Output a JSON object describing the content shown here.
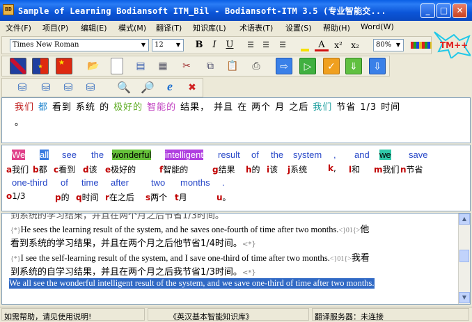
{
  "window": {
    "title": "Sample of Learning Bodiansoft ITM_Bil - Bodiansoft-ITM 3.5 (专业智能交...",
    "app_icon_text": "BD",
    "buttons": {
      "minimize": "_",
      "maximize": "□",
      "close": "✕"
    }
  },
  "menu": {
    "items": [
      "文件(F)",
      "项目(P)",
      "编辑(E)",
      "模式(M)",
      "翻译(T)",
      "知识库(L)",
      "术语表(T)",
      "设置(S)",
      "帮助(H)",
      "Word(W)"
    ]
  },
  "format_toolbar": {
    "font_name": "Times New Roman",
    "font_size": "12",
    "bold": "B",
    "italic": "I",
    "underline": "U",
    "superscript": "x²",
    "subscript": "x₂",
    "zoom": "80%"
  },
  "tm_badge": "TM++",
  "source_pane": {
    "words": [
      {
        "text": "我们",
        "color": "#C02020"
      },
      {
        "text": "都",
        "color": "#2A8AD0"
      },
      {
        "text": "看到",
        "color": "#000000"
      },
      {
        "text": "系统",
        "color": "#000000"
      },
      {
        "text": "的",
        "color": "#000000"
      },
      {
        "text": "极好的",
        "color": "#5AAA1E"
      },
      {
        "text": "智能的",
        "color": "#C040C0"
      },
      {
        "text": "结果，",
        "color": "#000000"
      },
      {
        "text": "并且",
        "color": "#000000"
      },
      {
        "text": "在",
        "color": "#000000"
      },
      {
        "text": "两个",
        "color": "#000000"
      },
      {
        "text": "月",
        "color": "#000000"
      },
      {
        "text": "之后",
        "color": "#000000"
      },
      {
        "text": "我们",
        "color": "#20A0A0"
      },
      {
        "text": "节省",
        "color": "#000000"
      },
      {
        "text": "1/3",
        "color": "#000000"
      },
      {
        "text": "时间",
        "color": "#000000"
      }
    ],
    "end_mark": "。"
  },
  "alignment_pane": {
    "english_row1": [
      {
        "text": "We",
        "bg": "#E0408A"
      },
      {
        "text": "all",
        "bg": "#3A7CE0"
      },
      {
        "text": "see",
        "bg": ""
      },
      {
        "text": "the",
        "bg": ""
      },
      {
        "text": "wonderful",
        "bg": "#66C23A"
      },
      {
        "text": "intelligent",
        "bg": "#B040E0"
      },
      {
        "text": "result",
        "bg": ""
      },
      {
        "text": "of",
        "bg": ""
      },
      {
        "text": "the",
        "bg": ""
      },
      {
        "text": "system",
        "bg": ""
      },
      {
        "text": ",",
        "bg": ""
      },
      {
        "text": "and",
        "bg": ""
      },
      {
        "text": "we",
        "bg": "#30C8A8"
      },
      {
        "text": "save",
        "bg": ""
      }
    ],
    "chinese_row1": [
      {
        "tag": "a",
        "text": "我们"
      },
      {
        "tag": "b",
        "text": "都"
      },
      {
        "tag": "c",
        "text": "看到"
      },
      {
        "tag": "d",
        "text": "该"
      },
      {
        "tag": "e",
        "text": "极好的"
      },
      {
        "tag": "f",
        "text": "智能的"
      },
      {
        "tag": "g",
        "text": "结果"
      },
      {
        "tag": "h",
        "text": "的"
      },
      {
        "tag": "i",
        "text": "该"
      },
      {
        "tag": "j",
        "text": "系统"
      },
      {
        "tag": "k",
        "text": ","
      },
      {
        "tag": "l",
        "text": "和"
      },
      {
        "tag": "m",
        "text": "我们"
      },
      {
        "tag": "n",
        "text": "节省"
      }
    ],
    "english_row2": [
      "one-third",
      "of",
      "time",
      "after",
      "two",
      "months",
      "."
    ],
    "chinese_row2": [
      {
        "tag": "o",
        "text": "1/3"
      },
      {
        "tag": "p",
        "text": "的"
      },
      {
        "tag": "q",
        "text": "时间"
      },
      {
        "tag": "r",
        "text": "在之后"
      },
      {
        "tag": "s",
        "text": "两个"
      },
      {
        "tag": "t",
        "text": "月"
      },
      {
        "tag": "u",
        "text": "。"
      }
    ]
  },
  "memory_pane": {
    "partial_line": "到系统的学习结果，并且在两个月之后节省1/3时间。",
    "entries": [
      {
        "open_tag": "{*}",
        "english": "He sees the learning result of the system, and he saves one-fourth of time after two months.",
        "mid_tag": "<}01{>",
        "chinese_start": "他"
      },
      {
        "chinese_rest": "看到系统的学习结果，并且在两个月之后他节省1/4时间。",
        "close_tag": "<*}"
      },
      {
        "open_tag": "{*}",
        "english": "I see the self-learning result of the system, and I save one-third of time after two months.",
        "mid_tag": "<}01{>",
        "chinese_start": "我看"
      },
      {
        "chinese_rest": "到系统的自学习结果，并且在两个月之后我节省1/3时间。",
        "close_tag": "<*}"
      }
    ],
    "selected_line": "We all see the wonderful intelligent result of the system, and we save one-third of time after two months."
  },
  "status_bar": {
    "help": "如需帮助，请见使用说明!",
    "kb": "《英汉基本智能知识库》",
    "server": "翻译服务器：未连接"
  }
}
